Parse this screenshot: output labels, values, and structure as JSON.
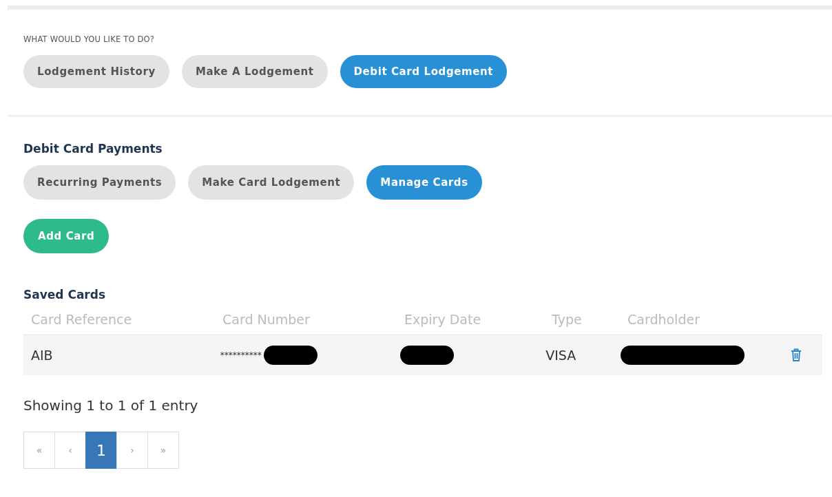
{
  "prompt": "WHAT WOULD YOU LIKE TO DO?",
  "main_tabs": [
    {
      "label": "Lodgement History",
      "selected": false
    },
    {
      "label": "Make A Lodgement",
      "selected": false
    },
    {
      "label": "Debit Card Lodgement",
      "selected": true
    }
  ],
  "section_title": "Debit Card Payments",
  "sub_tabs": [
    {
      "label": "Recurring Payments",
      "selected": false
    },
    {
      "label": "Make Card Lodgement",
      "selected": false
    },
    {
      "label": "Manage Cards",
      "selected": true
    }
  ],
  "add_button": "Add Card",
  "table_title": "Saved Cards",
  "table": {
    "columns": [
      "Card Reference",
      "Card Number",
      "Expiry Date",
      "Type",
      "Cardholder"
    ],
    "rows": [
      {
        "cells": [
          {
            "text": "AIB",
            "redacted": false
          },
          {
            "text": "**********",
            "redacted": true
          },
          {
            "redacted": true
          },
          {
            "text": "VISA",
            "redacted": false
          },
          {
            "redacted": true
          }
        ]
      }
    ]
  },
  "info": "Showing 1 to 1 of 1 entry",
  "pagination": [
    {
      "label": "«",
      "selected": false
    },
    {
      "label": "‹",
      "selected": false
    },
    {
      "label": "1",
      "selected": true
    },
    {
      "label": "›",
      "selected": false
    },
    {
      "label": "»",
      "selected": false
    }
  ]
}
